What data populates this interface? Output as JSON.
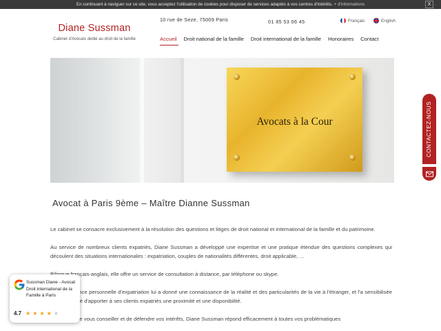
{
  "cookie_bar": {
    "text": "En continuant à naviguer sur ce site, vous acceptez l'utilisation de cookies pour disposer de services adaptés à vos centres d'intérêts.",
    "more_link": "+ d'informations",
    "close_label": "X"
  },
  "brand": {
    "name": "Diane Sussman",
    "tagline": "Cabinet d'Avocats dédié au droit de la famille"
  },
  "header": {
    "address": "10 rue de Seze, 75009 Paris",
    "phone": "01 85 53 06 45",
    "languages": [
      {
        "label": "Français",
        "icon": "french-flag-icon"
      },
      {
        "label": "English",
        "icon": "uk-flag-icon"
      }
    ]
  },
  "nav": {
    "items": [
      {
        "label": "Accueil",
        "active": true
      },
      {
        "label": "Droit national de la famille",
        "active": false
      },
      {
        "label": "Droit international de la famille",
        "active": false
      },
      {
        "label": "Honoraires",
        "active": false
      },
      {
        "label": "Contact",
        "active": false
      }
    ]
  },
  "hero": {
    "plaque_text": "Avocats à la Cour"
  },
  "main": {
    "title": "Avocat à Paris 9ème – Maître Dianne Sussman",
    "paragraphs": [
      "Le cabinet se consacre exclusivement à la résolution des questions et litiges de droit national et international de la famille et du patrimoine.",
      "Au service de nombreux clients expatriés, Diane Sussman a développé une expertise et une pratique étendue des questions complexes qui découlent des situations internationales : expatriation, couples de nationalités différentes, droit applicable, …",
      "Bilingue français-anglais, elle offre un service de consultation à distance, par téléphone ou skype.",
      "Son expérience personnelle d'expatriation lui a donné une connaissance de la réalité et des particularités de la vie à l'étranger, et l'a sensibilisée à la nécessité d'apporter à ses clients expatriés une proximité et une disponibilité.",
      "Soucieuse de vous conseiller et de défendre vos intérêts, Diane Sussman répond efficacement à toutes vos problématiques"
    ]
  },
  "contact_tab": {
    "label": "CONTACTEZ-NOUS",
    "mail_icon": "mail-icon"
  },
  "google_widget": {
    "name": "Sussman Diane - Avocat Droit international de la Famille à Paris",
    "rating": "4.7",
    "stars": "★★★★",
    "half_star": "★"
  },
  "colors": {
    "accent": "#b22222",
    "cookie_bar_bg": "#3a3a3a",
    "star": "#f4a213"
  }
}
